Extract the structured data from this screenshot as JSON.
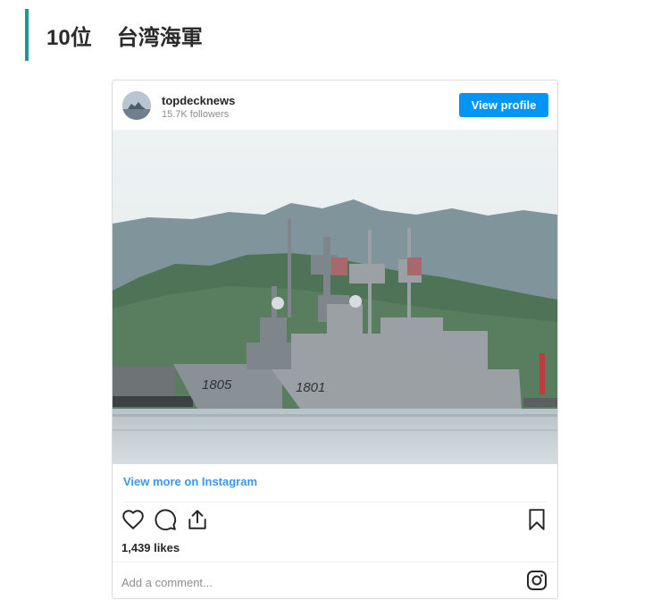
{
  "section": {
    "rank": "10位",
    "title": "台湾海軍"
  },
  "post": {
    "username": "topdecknews",
    "followers": "15.7K followers",
    "view_profile_label": "View profile",
    "image_hull_numbers": [
      "1805",
      "1801"
    ],
    "view_more_label": "View more on Instagram",
    "likes": "1,439 likes",
    "comment_placeholder": "Add a comment...",
    "icons": [
      "heart-icon",
      "comment-icon",
      "share-icon",
      "bookmark-icon",
      "instagram-logo-icon"
    ]
  },
  "colors": {
    "accent_bar": "#1a9a8e",
    "button": "#0095f6",
    "link": "#3897f0"
  }
}
